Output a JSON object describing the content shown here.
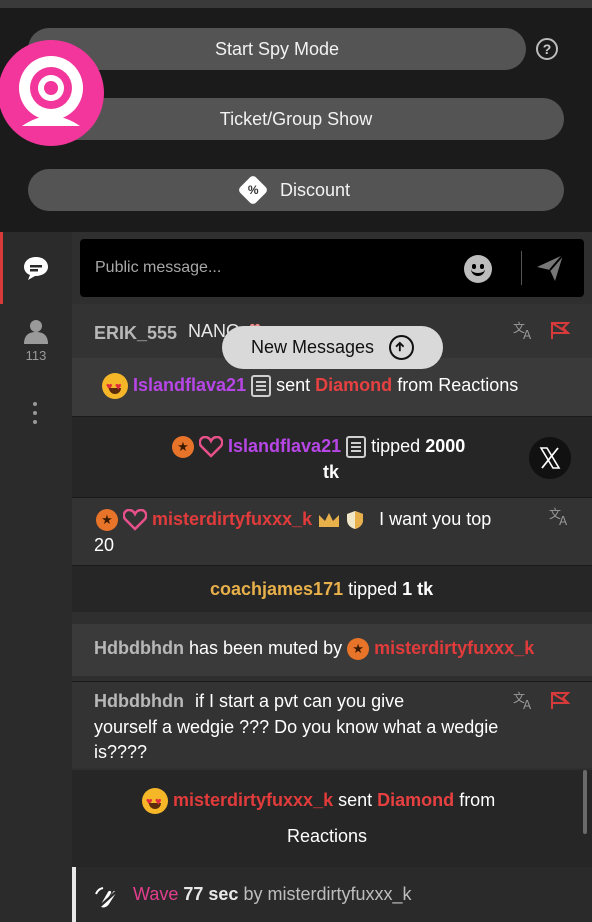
{
  "controls": {
    "spy_mode_label": "Start Spy Mode",
    "help_symbol": "?",
    "ticket_label": "Ticket/Group Show",
    "discount_symbol": "%",
    "discount_label": "Discount"
  },
  "sidebar": {
    "chat_icon": "chat-bubble-icon",
    "users_icon": "user-icon",
    "user_count": "113",
    "more_icon": "kebab-icon",
    "active_accent": "#d63a3a"
  },
  "input": {
    "placeholder": "Public message..."
  },
  "new_messages": {
    "label": "New Messages"
  },
  "messages": [
    {
      "user": "ERIK_555",
      "text": "NANO",
      "emoji": "heart"
    },
    {
      "user": "Islandflava21",
      "pre": "sent",
      "item": "Diamond",
      "post": "from Reactions"
    },
    {
      "user": "Islandflava21",
      "pre": "tipped",
      "amount": "2000",
      "unit": "tk"
    },
    {
      "user": "misterdirtyfuxxx_k",
      "text": "I want you top",
      "text2": "20"
    },
    {
      "user": "coachjames171",
      "pre": "tipped",
      "amount": "1 tk"
    },
    {
      "user": "Hdbdbhdn",
      "pre": "has been muted by",
      "by": "misterdirtyfuxxx_k"
    },
    {
      "user": "Hdbdbhdn",
      "text": "if I start a pvt can you give",
      "text2": "yourself a wedgie ??? Do you know what a wedgie",
      "text3": "is????"
    },
    {
      "user": "misterdirtyfuxxx_k",
      "pre": "sent",
      "item": "Diamond",
      "post": "from",
      "post2": "Reactions"
    }
  ],
  "wave": {
    "label": "Wave",
    "duration": "77 sec",
    "by": "by",
    "user": "misterdirtyfuxxx_k"
  },
  "colors": {
    "brand_pink": "#f2369b",
    "diamond_red": "#e64040",
    "purple_user": "#b746e6",
    "gold_user": "#e8b04a"
  }
}
